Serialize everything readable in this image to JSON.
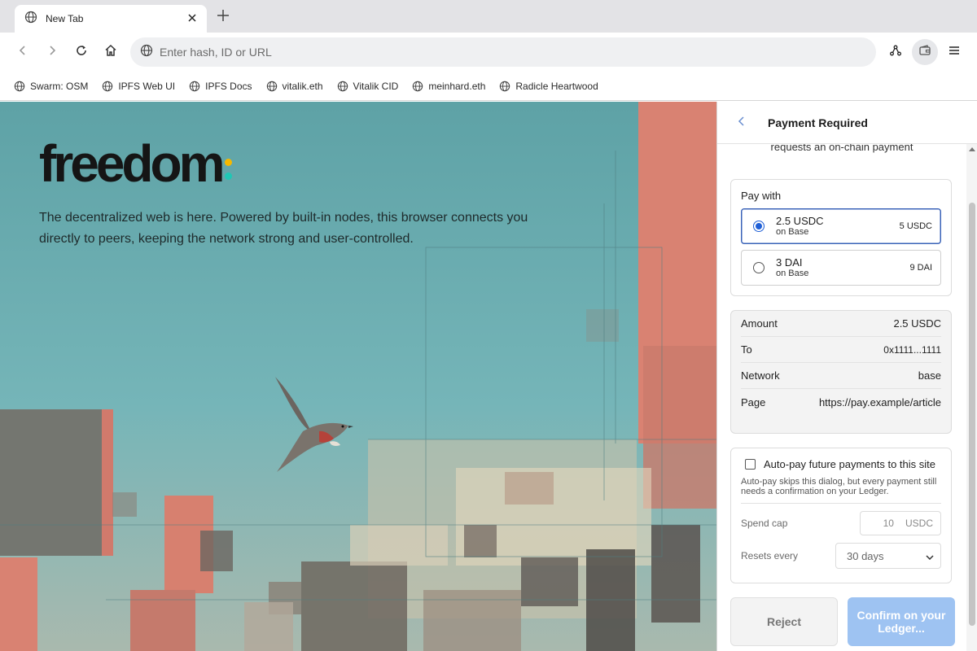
{
  "browser": {
    "tab": {
      "title": "New Tab"
    },
    "new_tab_label": "+",
    "omnibox": {
      "placeholder": "Enter hash, ID or URL",
      "value": ""
    },
    "bookmarks": [
      {
        "label": "Swarm: OSM"
      },
      {
        "label": "IPFS Web UI"
      },
      {
        "label": "IPFS Docs"
      },
      {
        "label": "vitalik.eth"
      },
      {
        "label": "Vitalik CID"
      },
      {
        "label": "meinhard.eth"
      },
      {
        "label": "Radicle Heartwood"
      }
    ],
    "icons": {
      "back": "arrow-left-icon",
      "forward": "arrow-right-icon",
      "reload": "reload-icon",
      "home": "home-icon",
      "network": "network-nodes-icon",
      "wallet": "wallet-icon",
      "menu": "hamburger-menu-icon"
    }
  },
  "newtab": {
    "logo_text": "freedom",
    "logo_dot_colors": [
      "#f5b800",
      "#1fc7b5"
    ],
    "tagline": "The decentralized web is here. Powered by built-in nodes, this browser connects you directly to peers, keeping the network strong and user-controlled."
  },
  "payment": {
    "title": "Payment Required",
    "subtext": "requests an on-chain payment",
    "pay_with": {
      "label": "Pay with",
      "options": [
        {
          "amount": "2.5 USDC",
          "network": "on Base",
          "balance": "5 USDC",
          "selected": true
        },
        {
          "amount": "3 DAI",
          "network": "on Base",
          "balance": "9 DAI",
          "selected": false
        }
      ]
    },
    "details": [
      {
        "label": "Amount",
        "value": "2.5 USDC"
      },
      {
        "label": "To",
        "value": "0x1111...1111"
      },
      {
        "label": "Network",
        "value": "base"
      },
      {
        "label": "Page",
        "value": "https://pay.example/article"
      }
    ],
    "auto_pay": {
      "checkbox_label": "Auto-pay future payments to this site",
      "checked": false,
      "note": "Auto-pay skips this dialog, but every payment still needs a confirmation on your Ledger.",
      "spend_cap_label": "Spend cap",
      "spend_cap_value": "10",
      "spend_cap_unit": "USDC",
      "resets_label": "Resets every",
      "resets_value": "30 days"
    },
    "buttons": {
      "reject": "Reject",
      "confirm": "Confirm on your Ledger..."
    },
    "colors": {
      "accent": "#1f5fd6",
      "confirm_disabled": "#9ec3f2"
    }
  }
}
